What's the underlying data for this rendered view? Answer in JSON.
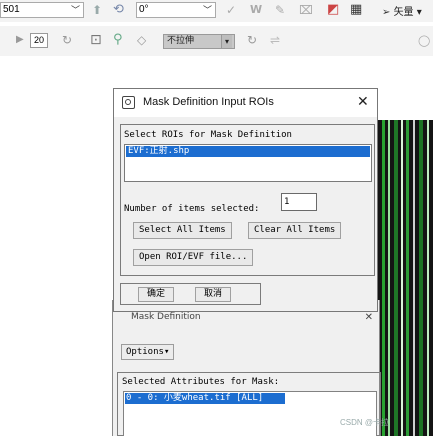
{
  "toolbar1": {
    "band_combo_value": "501",
    "angle_combo_value": "0°",
    "language_label": "矢量",
    "icons": [
      "cursor-icon",
      "rotate-icon",
      "check-icon",
      "w-icon",
      "pencil-icon",
      "tag-icon",
      "flip-icon",
      "layers-icon",
      "grid-icon",
      "cursor-vector-icon"
    ]
  },
  "toolbar2": {
    "zoom_value": "20",
    "stretch_value": "不拉伸",
    "icons": [
      "play-icon",
      "refresh-icon",
      "fit-icon",
      "magnify-icon",
      "pan-icon",
      "reload-icon",
      "compare-icon",
      "circle-icon"
    ]
  },
  "dialog": {
    "title": "Mask Definition Input ROIs",
    "close_symbol": "✕",
    "select_label": "Select ROIs for Mask Definition",
    "list_items": [
      "EVF:正射.shp"
    ],
    "num_items_label": "Number of items selected:",
    "num_items_value": "1",
    "select_all_label": "Select All Items",
    "clear_all_label": "Clear All Items",
    "open_roi_label": "Open ROI/EVF file...",
    "ok_label": "确定",
    "cancel_label": "取消"
  },
  "background_dialog": {
    "title": "Mask Definition",
    "close_symbol": "✕",
    "options_label": "Options",
    "selected_attributes_label": "Selected Attributes for Mask:",
    "attribute_items": [
      "0 - 0: 小麦wheat.tif [ALL]"
    ]
  },
  "watermark": "CSDN @卡拉"
}
